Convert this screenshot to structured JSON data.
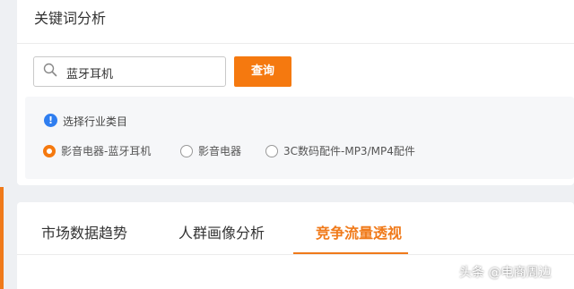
{
  "page_title": "关键词分析",
  "search": {
    "value": "蓝牙耳机",
    "icon": "search-icon"
  },
  "query_button": {
    "label": "查询",
    "color": "#f5790f"
  },
  "category": {
    "label": "选择行业类目",
    "options": [
      "影音电器-蓝牙耳机",
      "影音电器",
      "3C数码配件-MP3/MP4配件"
    ],
    "selected_index": 0
  },
  "tabs": [
    {
      "label": "市场数据趋势",
      "active": false
    },
    {
      "label": "人群画像分析",
      "active": false
    },
    {
      "label": "竞争流量透视",
      "active": true
    }
  ],
  "watermark": "头条 @电商周边",
  "colors": {
    "accent": "#f07a1a",
    "info": "#2f7ef0"
  }
}
